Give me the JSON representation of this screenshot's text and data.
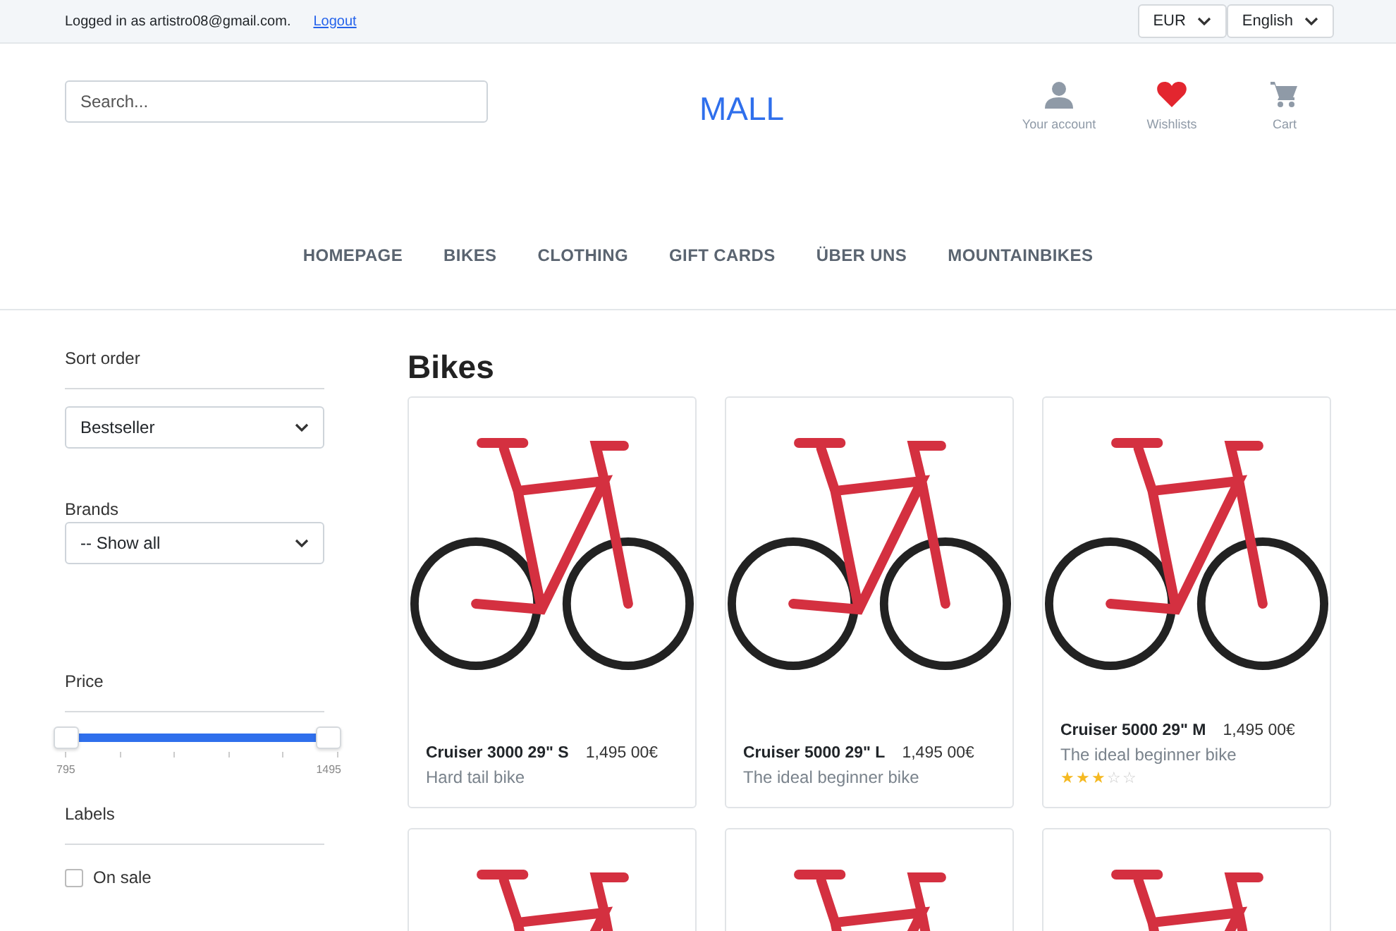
{
  "top_bar": {
    "login_text": "Logged in as artistro08@gmail.com.",
    "logout_link": "Logout",
    "currency": "EUR",
    "language": "English"
  },
  "header": {
    "search": {
      "placeholder": "Search..."
    },
    "logo": "MALL",
    "actions": [
      {
        "kind": "account",
        "label": "Your account"
      },
      {
        "kind": "wishlist",
        "label": "Wishlists"
      },
      {
        "kind": "cart",
        "label": "Cart"
      }
    ]
  },
  "nav": [
    "HOMEPAGE",
    "BIKES",
    "CLOTHING",
    "GIFT CARDS",
    "ÜBER UNS",
    "MOUNTAINBIKES"
  ],
  "sidebar": {
    "sort": {
      "title": "Sort order",
      "value": "Bestseller"
    },
    "brands": {
      "title": "Brands",
      "value": "-- Show all"
    },
    "price": {
      "title": "Price",
      "level": 1,
      "min_label": "795",
      "max_label": "1495"
    },
    "labels": {
      "title": "Labels",
      "options": [
        {
          "label": "On sale",
          "checked": false
        }
      ]
    }
  },
  "page_title": "Bikes",
  "products": [
    {
      "kind": "details",
      "name": "Cruiser 3000 29\" S",
      "price": "1,495 00€",
      "subtitle": "Hard tail bike"
    },
    {
      "kind": "details",
      "name": "Cruiser 5000 29\" L",
      "price": "1,495 00€",
      "subtitle": "The ideal beginner bike"
    },
    {
      "kind": "details",
      "name": "Cruiser 5000 29\" M",
      "price": "1,495 00€",
      "subtitle": "The ideal beginner bike",
      "stars": 3
    },
    {
      "kind": "image"
    },
    {
      "kind": "image"
    },
    {
      "kind": "image"
    }
  ]
}
